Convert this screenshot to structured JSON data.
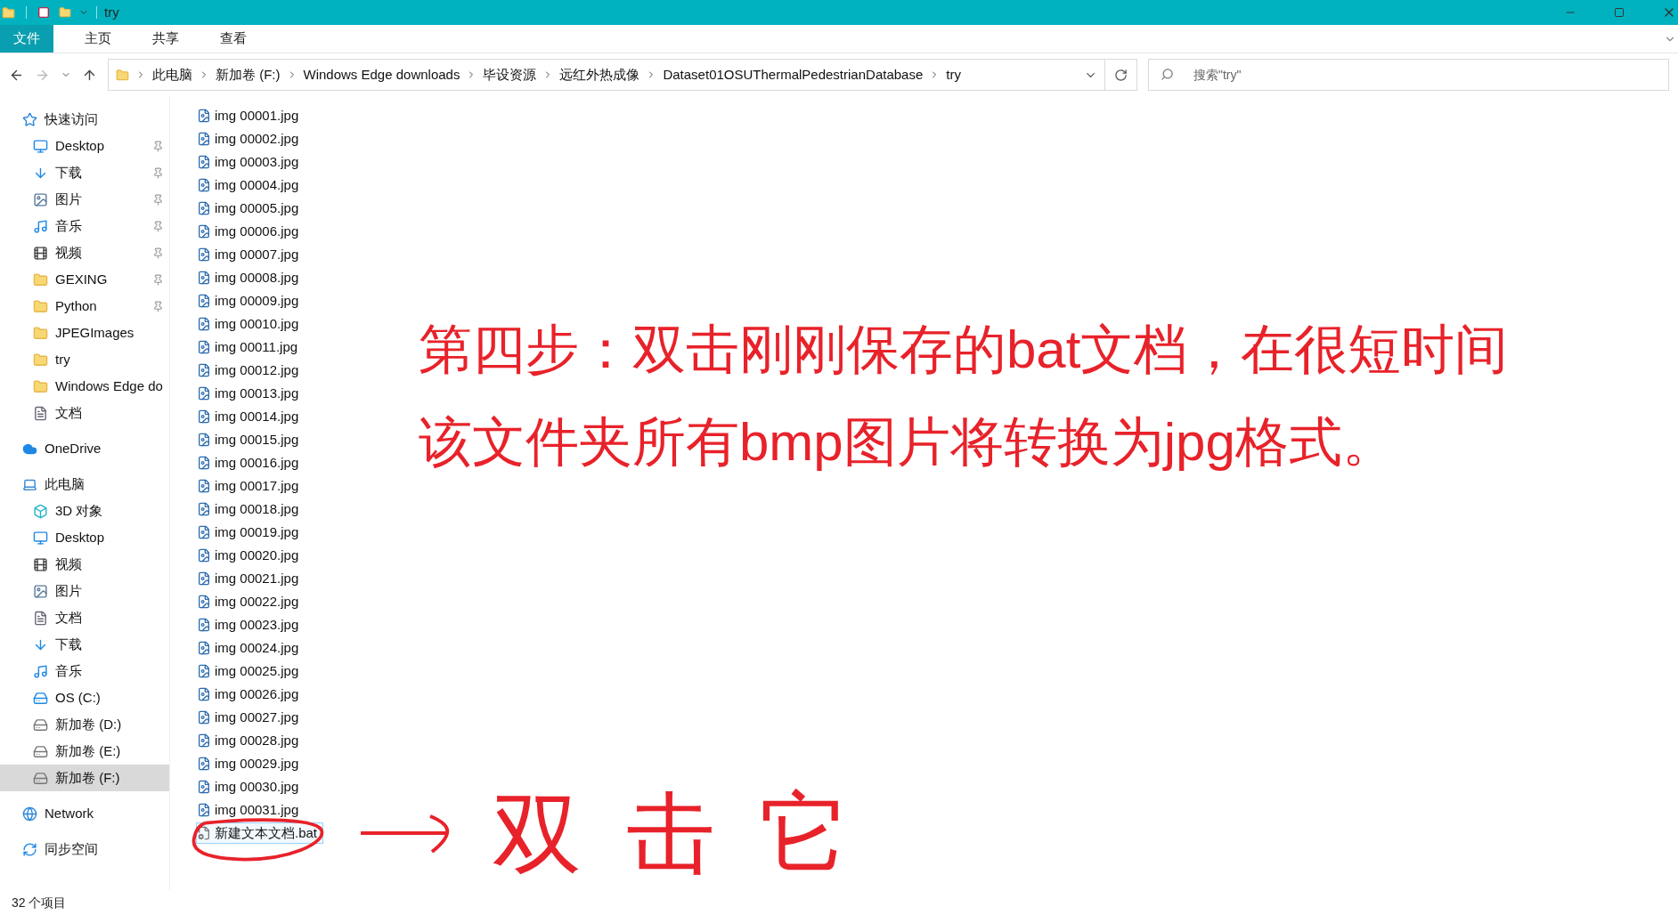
{
  "window": {
    "title": "try"
  },
  "ribbon_tabs": [
    {
      "label": "文件",
      "selected": true
    },
    {
      "label": "主页",
      "selected": false
    },
    {
      "label": "共享",
      "selected": false
    },
    {
      "label": "查看",
      "selected": false
    }
  ],
  "address": {
    "path": [
      "此电脑",
      "新加卷 (F:)",
      "Windows Edge downloads",
      "毕设资源",
      "远红外热成像",
      "Dataset01OSUThermalPedestrianDatabase",
      "try"
    ],
    "search_placeholder": "搜索\"try\""
  },
  "sidebar": [
    {
      "label": "快速访问",
      "kind": "star",
      "selected": false,
      "children": [
        {
          "label": "Desktop",
          "kind": "desktop",
          "pinned": true,
          "selected": false
        },
        {
          "label": "下载",
          "kind": "download",
          "pinned": true,
          "selected": false
        },
        {
          "label": "图片",
          "kind": "pictures",
          "pinned": true,
          "selected": false
        },
        {
          "label": "音乐",
          "kind": "music",
          "pinned": true,
          "selected": false
        },
        {
          "label": "视频",
          "kind": "video",
          "pinned": true,
          "selected": false
        },
        {
          "label": "GEXING",
          "kind": "folder",
          "pinned": true,
          "selected": false
        },
        {
          "label": "Python",
          "kind": "folder",
          "pinned": true,
          "selected": false
        },
        {
          "label": "JPEGImages",
          "kind": "folder",
          "pinned": false,
          "selected": false
        },
        {
          "label": "try",
          "kind": "folder",
          "pinned": false,
          "selected": false
        },
        {
          "label": "Windows Edge do",
          "kind": "folder",
          "pinned": false,
          "selected": false
        },
        {
          "label": "文档",
          "kind": "document",
          "pinned": false,
          "selected": false
        }
      ]
    },
    {
      "label": "OneDrive",
      "kind": "cloud",
      "selected": false
    },
    {
      "label": "此电脑",
      "kind": "pc",
      "selected": false,
      "children": [
        {
          "label": "3D 对象",
          "kind": "cube",
          "pinned": false,
          "selected": false
        },
        {
          "label": "Desktop",
          "kind": "desktop",
          "pinned": false,
          "selected": false
        },
        {
          "label": "视频",
          "kind": "video",
          "pinned": false,
          "selected": false
        },
        {
          "label": "图片",
          "kind": "pictures",
          "pinned": false,
          "selected": false
        },
        {
          "label": "文档",
          "kind": "document",
          "pinned": false,
          "selected": false
        },
        {
          "label": "下载",
          "kind": "download",
          "pinned": false,
          "selected": false
        },
        {
          "label": "音乐",
          "kind": "music",
          "pinned": false,
          "selected": false
        },
        {
          "label": "OS (C:)",
          "kind": "drive_os",
          "pinned": false,
          "selected": false
        },
        {
          "label": "新加卷 (D:)",
          "kind": "drive",
          "pinned": false,
          "selected": false
        },
        {
          "label": "新加卷 (E:)",
          "kind": "drive",
          "pinned": false,
          "selected": false
        },
        {
          "label": "新加卷 (F:)",
          "kind": "drive",
          "pinned": false,
          "selected": true
        }
      ]
    },
    {
      "label": "Network",
      "kind": "network",
      "selected": false
    },
    {
      "label": "同步空间",
      "kind": "sync",
      "selected": false
    }
  ],
  "files": [
    {
      "name": "img 00001.jpg",
      "kind": "image",
      "selected": false
    },
    {
      "name": "img 00002.jpg",
      "kind": "image",
      "selected": false
    },
    {
      "name": "img 00003.jpg",
      "kind": "image",
      "selected": false
    },
    {
      "name": "img 00004.jpg",
      "kind": "image",
      "selected": false
    },
    {
      "name": "img 00005.jpg",
      "kind": "image",
      "selected": false
    },
    {
      "name": "img 00006.jpg",
      "kind": "image",
      "selected": false
    },
    {
      "name": "img 00007.jpg",
      "kind": "image",
      "selected": false
    },
    {
      "name": "img 00008.jpg",
      "kind": "image",
      "selected": false
    },
    {
      "name": "img 00009.jpg",
      "kind": "image",
      "selected": false
    },
    {
      "name": "img 00010.jpg",
      "kind": "image",
      "selected": false
    },
    {
      "name": "img 00011.jpg",
      "kind": "image",
      "selected": false
    },
    {
      "name": "img 00012.jpg",
      "kind": "image",
      "selected": false
    },
    {
      "name": "img 00013.jpg",
      "kind": "image",
      "selected": false
    },
    {
      "name": "img 00014.jpg",
      "kind": "image",
      "selected": false
    },
    {
      "name": "img 00015.jpg",
      "kind": "image",
      "selected": false
    },
    {
      "name": "img 00016.jpg",
      "kind": "image",
      "selected": false
    },
    {
      "name": "img 00017.jpg",
      "kind": "image",
      "selected": false
    },
    {
      "name": "img 00018.jpg",
      "kind": "image",
      "selected": false
    },
    {
      "name": "img 00019.jpg",
      "kind": "image",
      "selected": false
    },
    {
      "name": "img 00020.jpg",
      "kind": "image",
      "selected": false
    },
    {
      "name": "img 00021.jpg",
      "kind": "image",
      "selected": false
    },
    {
      "name": "img 00022.jpg",
      "kind": "image",
      "selected": false
    },
    {
      "name": "img 00023.jpg",
      "kind": "image",
      "selected": false
    },
    {
      "name": "img 00024.jpg",
      "kind": "image",
      "selected": false
    },
    {
      "name": "img 00025.jpg",
      "kind": "image",
      "selected": false
    },
    {
      "name": "img 00026.jpg",
      "kind": "image",
      "selected": false
    },
    {
      "name": "img 00027.jpg",
      "kind": "image",
      "selected": false
    },
    {
      "name": "img 00028.jpg",
      "kind": "image",
      "selected": false
    },
    {
      "name": "img 00029.jpg",
      "kind": "image",
      "selected": false
    },
    {
      "name": "img 00030.jpg",
      "kind": "image",
      "selected": false
    },
    {
      "name": "img 00031.jpg",
      "kind": "image",
      "selected": false
    },
    {
      "name": "新建文本文档.bat",
      "kind": "batch",
      "selected": true
    }
  ],
  "annotation": {
    "lines": [
      "第四步：双击刚刚保存的bat文档，在很短时间",
      "该文件夹所有bmp图片将转换为jpg格式。"
    ],
    "handwritten": "双击它"
  },
  "status_bar": {
    "count": "32 个项目"
  }
}
